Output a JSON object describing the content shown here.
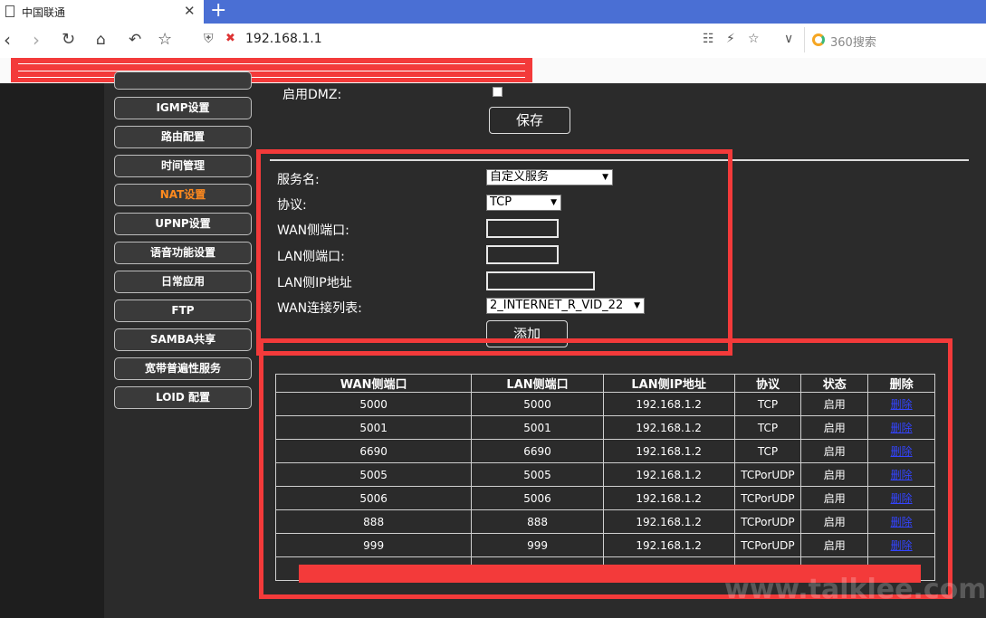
{
  "browser": {
    "tab_title": "中国联通",
    "tab_close": "✕",
    "new_tab": "+",
    "url": "192.168.1.1",
    "search_placeholder": "360搜索"
  },
  "sidebar": {
    "items": [
      {
        "label": "IGMP设置",
        "active": false
      },
      {
        "label": "路由配置",
        "active": false
      },
      {
        "label": "时间管理",
        "active": false
      },
      {
        "label": "NAT设置",
        "active": true
      },
      {
        "label": "UPNP设置",
        "active": false
      },
      {
        "label": "语音功能设置",
        "active": false
      },
      {
        "label": "日常应用",
        "active": false
      },
      {
        "label": "FTP",
        "active": false
      },
      {
        "label": "SAMBA共享",
        "active": false
      },
      {
        "label": "宽带普遍性服务",
        "active": false
      },
      {
        "label": "LOID 配置",
        "active": false
      }
    ]
  },
  "dmz": {
    "label": "启用DMZ:",
    "save_label": "保存"
  },
  "form": {
    "service_label": "服务名:",
    "service_value": "自定义服务",
    "protocol_label": "协议:",
    "protocol_value": "TCP",
    "wan_port_label": "WAN侧端口:",
    "lan_port_label": "LAN侧端口:",
    "lan_ip_label": "LAN侧IP地址",
    "wan_list_label": "WAN连接列表:",
    "wan_list_value": "2_INTERNET_R_VID_22",
    "add_label": "添加"
  },
  "table": {
    "headers": [
      "WAN侧端口",
      "LAN侧端口",
      "LAN侧IP地址",
      "协议",
      "状态",
      "删除"
    ],
    "rows": [
      [
        "5000",
        "5000",
        "192.168.1.2",
        "TCP",
        "启用",
        "删除"
      ],
      [
        "5001",
        "5001",
        "192.168.1.2",
        "TCP",
        "启用",
        "删除"
      ],
      [
        "6690",
        "6690",
        "192.168.1.2",
        "TCP",
        "启用",
        "删除"
      ],
      [
        "5005",
        "5005",
        "192.168.1.2",
        "TCPorUDP",
        "启用",
        "删除"
      ],
      [
        "5006",
        "5006",
        "192.168.1.2",
        "TCPorUDP",
        "启用",
        "删除"
      ],
      [
        "888",
        "888",
        "192.168.1.2",
        "TCPorUDP",
        "启用",
        "删除"
      ],
      [
        "999",
        "999",
        "192.168.1.2",
        "TCPorUDP",
        "启用",
        "删除"
      ]
    ]
  },
  "watermark": {
    "text": "www.talklee.com"
  },
  "colors": {
    "highlight": "#f33a3a",
    "active_menu": "#ff8a1e",
    "link": "#3344ff"
  }
}
